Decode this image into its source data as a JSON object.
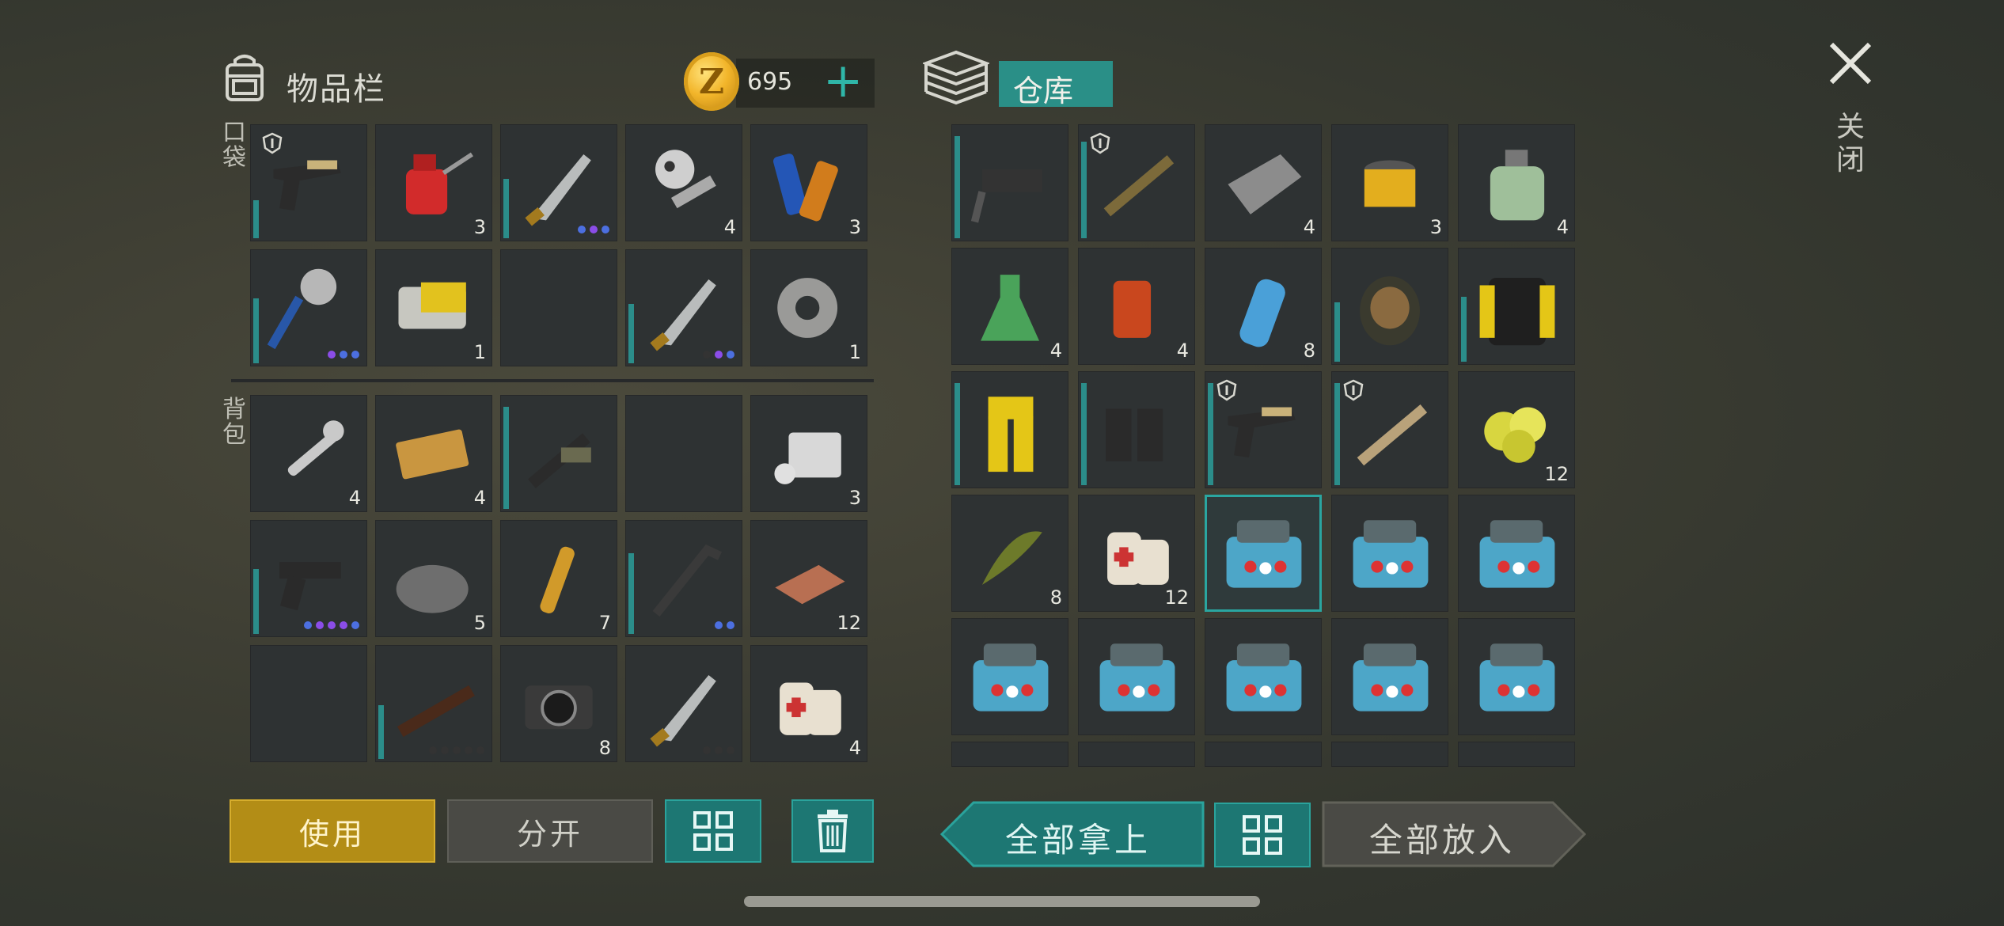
{
  "inventory": {
    "title": "物品栏",
    "coins": "695",
    "coin_letter": "Z",
    "pocket_label": "口袋",
    "backpack_label": "背包",
    "pocket": [
      {
        "name": "desert-pistol-item",
        "count": "",
        "shield": true,
        "dur": 0.35,
        "dots": []
      },
      {
        "name": "oil-can-item",
        "count": "3",
        "shield": false,
        "dur": 0,
        "dots": []
      },
      {
        "name": "machete-item",
        "count": "",
        "shield": false,
        "dur": 0.55,
        "dots": [
          "#4c6fe0",
          "#8b4de8",
          "#4c6fe0"
        ]
      },
      {
        "name": "engine-parts-item",
        "count": "4",
        "shield": false,
        "dur": 0,
        "dots": []
      },
      {
        "name": "batteries-item",
        "count": "3",
        "shield": false,
        "dur": 0,
        "dots": []
      },
      {
        "name": "saw-club-item",
        "count": "",
        "shield": false,
        "dur": 0.6,
        "dots": [
          "#8b4de8",
          "#4c6fe0",
          "#4c6fe0"
        ]
      },
      {
        "name": "power-cell-item",
        "count": "1",
        "shield": false,
        "dur": 0,
        "dots": []
      },
      {
        "name": "empty-slot",
        "count": "",
        "shield": false,
        "dur": 0,
        "dots": []
      },
      {
        "name": "machete-item",
        "count": "",
        "shield": false,
        "dur": 0.55,
        "dots": [
          "#333",
          "#8b4de8",
          "#4c6fe0"
        ]
      },
      {
        "name": "gear-item",
        "count": "1",
        "shield": false,
        "dur": 0,
        "dots": []
      }
    ],
    "backpack": [
      {
        "name": "wrench-item",
        "count": "4",
        "shield": false,
        "dur": 0,
        "dots": []
      },
      {
        "name": "survival-coupon-item",
        "count": "4",
        "shield": false,
        "dur": 0,
        "dots": []
      },
      {
        "name": "scoped-rifle-item",
        "count": "",
        "shield": false,
        "dur": 0.95,
        "dots": []
      },
      {
        "name": "empty-slot",
        "count": "",
        "shield": false,
        "dur": 0,
        "dots": []
      },
      {
        "name": "cylinder-item",
        "count": "3",
        "shield": false,
        "dur": 0,
        "dots": []
      },
      {
        "name": "glock-pistol-item",
        "count": "",
        "shield": false,
        "dur": 0.6,
        "dots": [
          "#4c6fe0",
          "#8b4de8",
          "#8b4de8",
          "#8b4de8",
          "#4c6fe0"
        ]
      },
      {
        "name": "scrap-pile-item",
        "count": "5",
        "shield": false,
        "dur": 0,
        "dots": []
      },
      {
        "name": "ampoule-item",
        "count": "7",
        "shield": false,
        "dur": 0,
        "dots": []
      },
      {
        "name": "crowbar-item",
        "count": "",
        "shield": false,
        "dur": 0.75,
        "dots": [
          "#4c6fe0",
          "#4c6fe0"
        ]
      },
      {
        "name": "copper-ingot-item",
        "count": "12",
        "shield": false,
        "dur": 0,
        "dots": []
      },
      {
        "name": "empty-slot",
        "count": "",
        "shield": false,
        "dur": 0,
        "dots": []
      },
      {
        "name": "pump-shotgun-item",
        "count": "",
        "shield": false,
        "dur": 0.5,
        "dots": [
          "#333",
          "#333",
          "#333",
          "#333",
          "#333"
        ]
      },
      {
        "name": "camera-item",
        "count": "8",
        "shield": false,
        "dur": 0,
        "dots": []
      },
      {
        "name": "machete-item",
        "count": "",
        "shield": false,
        "dur": 0,
        "dots": [
          "#333",
          "#333",
          "#333"
        ]
      },
      {
        "name": "bandage-item",
        "count": "4",
        "shield": false,
        "dur": 0,
        "dots": []
      }
    ]
  },
  "warehouse": {
    "title": "仓库",
    "items": [
      {
        "name": "drill-item",
        "count": "",
        "shield": false,
        "dur": 0.95,
        "dots": []
      },
      {
        "name": "assault-rifle-item",
        "count": "",
        "shield": true,
        "dur": 0.9,
        "dots": []
      },
      {
        "name": "fabric-roll-item",
        "count": "4",
        "shield": false,
        "dur": 0,
        "dots": []
      },
      {
        "name": "air-filter-item",
        "count": "3",
        "shield": false,
        "dur": 0,
        "dots": []
      },
      {
        "name": "chemical-bottle-item",
        "count": "4",
        "shield": false,
        "dur": 0,
        "dots": []
      },
      {
        "name": "flask-item",
        "count": "4",
        "shield": false,
        "dur": 0,
        "dots": []
      },
      {
        "name": "spice-jar-item",
        "count": "4",
        "shield": false,
        "dur": 0,
        "dots": []
      },
      {
        "name": "water-bottle-item",
        "count": "8",
        "shield": false,
        "dur": 0,
        "dots": []
      },
      {
        "name": "gas-mask-item",
        "count": "",
        "shield": false,
        "dur": 0.55,
        "dots": []
      },
      {
        "name": "armored-jacket-item",
        "count": "",
        "shield": false,
        "dur": 0.6,
        "dots": []
      },
      {
        "name": "hazmat-pants-item",
        "count": "",
        "shield": false,
        "dur": 0.95,
        "dots": []
      },
      {
        "name": "boots-item",
        "count": "",
        "shield": false,
        "dur": 0.95,
        "dots": []
      },
      {
        "name": "desert-pistol-item",
        "count": "",
        "shield": true,
        "dur": 0.95,
        "dots": []
      },
      {
        "name": "scoped-smg-item",
        "count": "",
        "shield": true,
        "dur": 0.95,
        "dots": []
      },
      {
        "name": "sulfur-item",
        "count": "12",
        "shield": false,
        "dur": 0,
        "dots": []
      },
      {
        "name": "herb-item",
        "count": "8",
        "shield": false,
        "dur": 0,
        "dots": []
      },
      {
        "name": "bandage-item",
        "count": "12",
        "shield": false,
        "dur": 0,
        "dots": []
      },
      {
        "name": "medkit-item",
        "count": "",
        "shield": false,
        "dur": 0,
        "dots": [],
        "selected": true
      },
      {
        "name": "medkit-item",
        "count": "",
        "shield": false,
        "dur": 0,
        "dots": []
      },
      {
        "name": "medkit-item",
        "count": "",
        "shield": false,
        "dur": 0,
        "dots": []
      },
      {
        "name": "medkit-item",
        "count": "",
        "shield": false,
        "dur": 0,
        "dots": []
      },
      {
        "name": "medkit-item",
        "count": "",
        "shield": false,
        "dur": 0,
        "dots": []
      },
      {
        "name": "medkit-item",
        "count": "",
        "shield": false,
        "dur": 0,
        "dots": []
      },
      {
        "name": "medkit-item",
        "count": "",
        "shield": false,
        "dur": 0,
        "dots": []
      },
      {
        "name": "medkit-item",
        "count": "",
        "shield": false,
        "dur": 0,
        "dots": []
      }
    ]
  },
  "close_label": "关闭",
  "buttons": {
    "use": "使用",
    "split": "分开",
    "take_all": "全部拿上",
    "put_all": "全部放入"
  },
  "colors": {
    "accent_teal": "#2aa39c",
    "use_gold": "#b38d16",
    "durability": "#2b8d8a"
  }
}
